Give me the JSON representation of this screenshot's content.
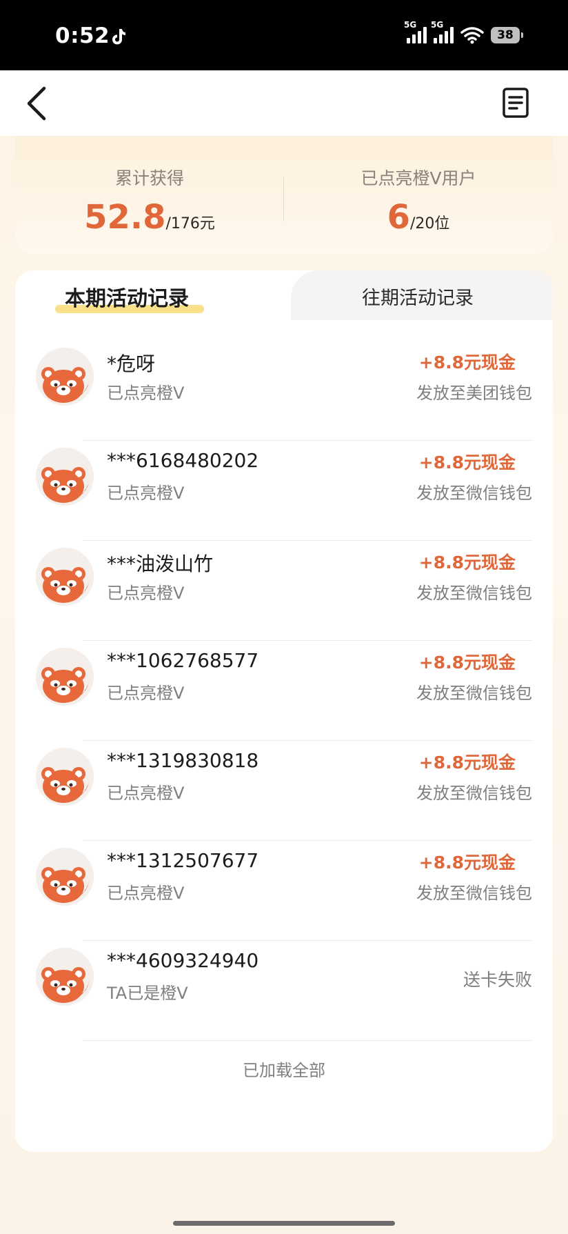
{
  "status_bar": {
    "time": "0:52",
    "signal1_tag": "5G",
    "signal2_tag": "5G",
    "battery": "38"
  },
  "summary": {
    "earned_label": "累计获得",
    "earned_value": "52.8",
    "earned_total": "/176元",
    "users_label": "已点亮橙V用户",
    "users_value": "6",
    "users_total": "/20位"
  },
  "tabs": {
    "current": "本期活动记录",
    "past": "往期活动记录"
  },
  "records": [
    {
      "name": "*危呀",
      "status": "已点亮橙V",
      "amount": "+8.8元现金",
      "destination": "发放至美团钱包"
    },
    {
      "name": "***6168480202",
      "status": "已点亮橙V",
      "amount": "+8.8元现金",
      "destination": "发放至微信钱包"
    },
    {
      "name": "***油泼山竹",
      "status": "已点亮橙V",
      "amount": "+8.8元现金",
      "destination": "发放至微信钱包"
    },
    {
      "name": "***1062768577",
      "status": "已点亮橙V",
      "amount": "+8.8元现金",
      "destination": "发放至微信钱包"
    },
    {
      "name": "***1319830818",
      "status": "已点亮橙V",
      "amount": "+8.8元现金",
      "destination": "发放至微信钱包"
    },
    {
      "name": "***1312507677",
      "status": "已点亮橙V",
      "amount": "+8.8元现金",
      "destination": "发放至微信钱包"
    },
    {
      "name": "***4609324940",
      "status": "TA已是橙V",
      "result": "送卡失败"
    }
  ],
  "footer": "已加载全部",
  "colors": {
    "accent": "#e0673a",
    "highlight": "#f8dc78"
  }
}
